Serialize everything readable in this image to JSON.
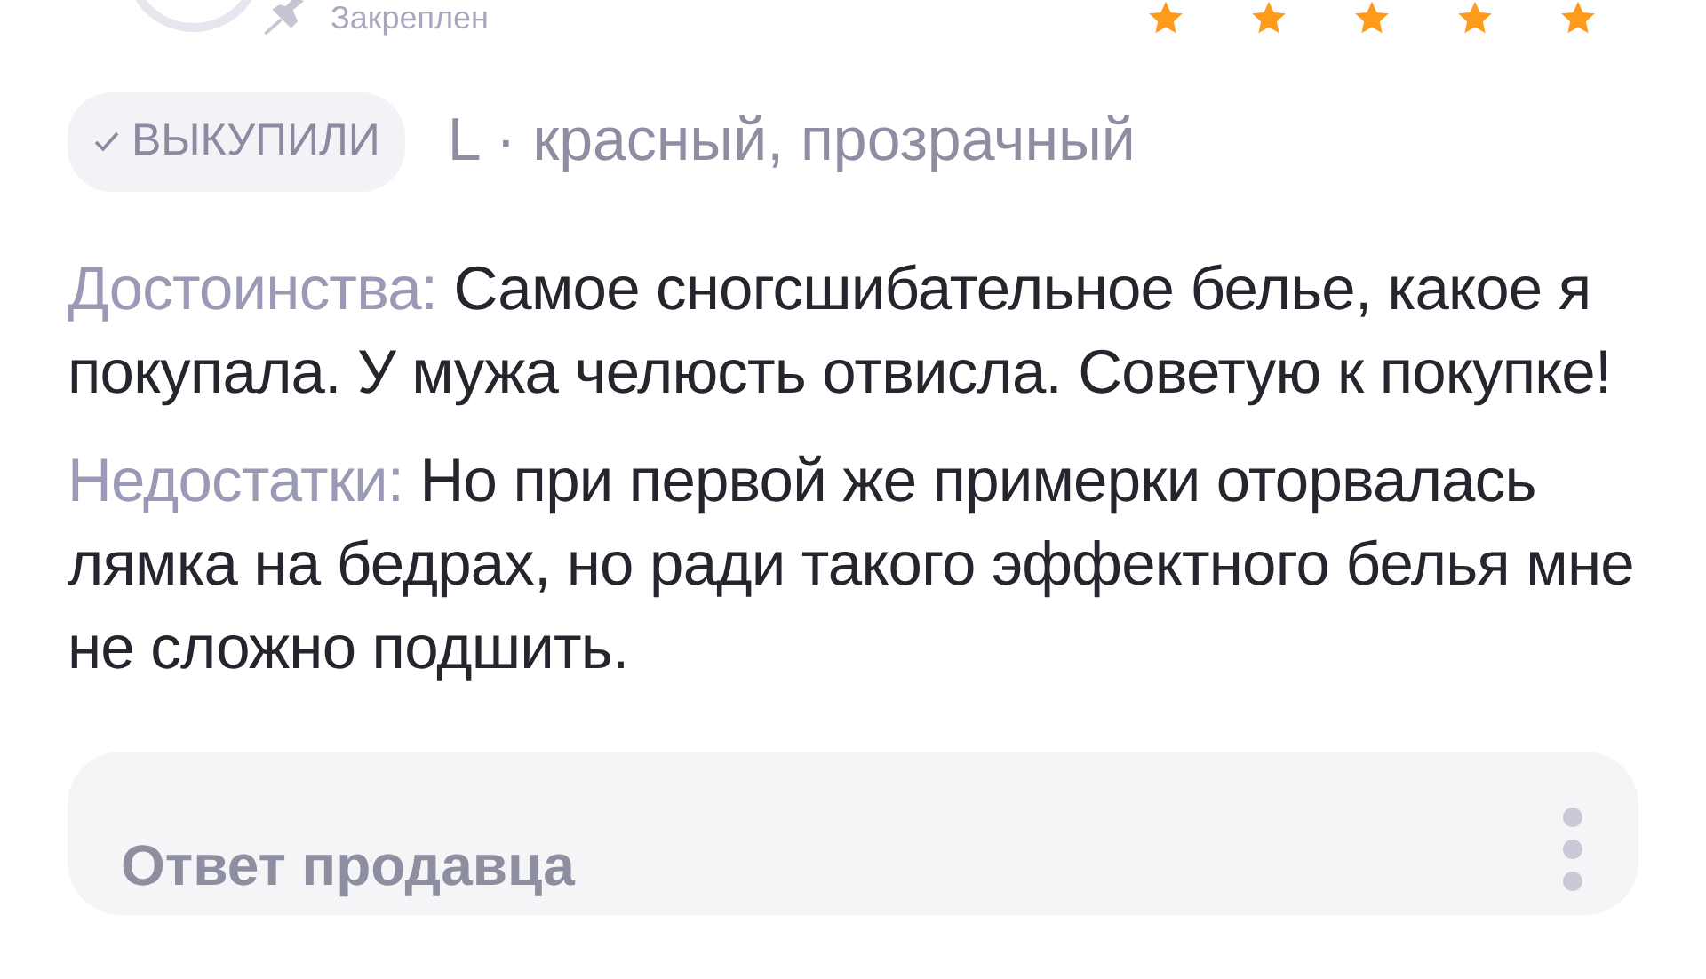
{
  "review_header": {
    "pinned_label": "Закреплен",
    "stars": 5
  },
  "purchase": {
    "badge": "ВЫКУПИЛИ",
    "variant": "L · красный, прозрачный"
  },
  "sections": [
    {
      "label": "Достоинства:",
      "text": "Самое сногсшибательное белье, какое я покупала. У мужа челюсть отвисла. Советую к покупке!"
    },
    {
      "label": "Недостатки:",
      "text": "Но при первой же примерки оторвалась лямка на бедрах, но ради такого эффектного белья мне не сложно подшить."
    }
  ],
  "seller_reply": {
    "title": "Ответ продавца"
  }
}
